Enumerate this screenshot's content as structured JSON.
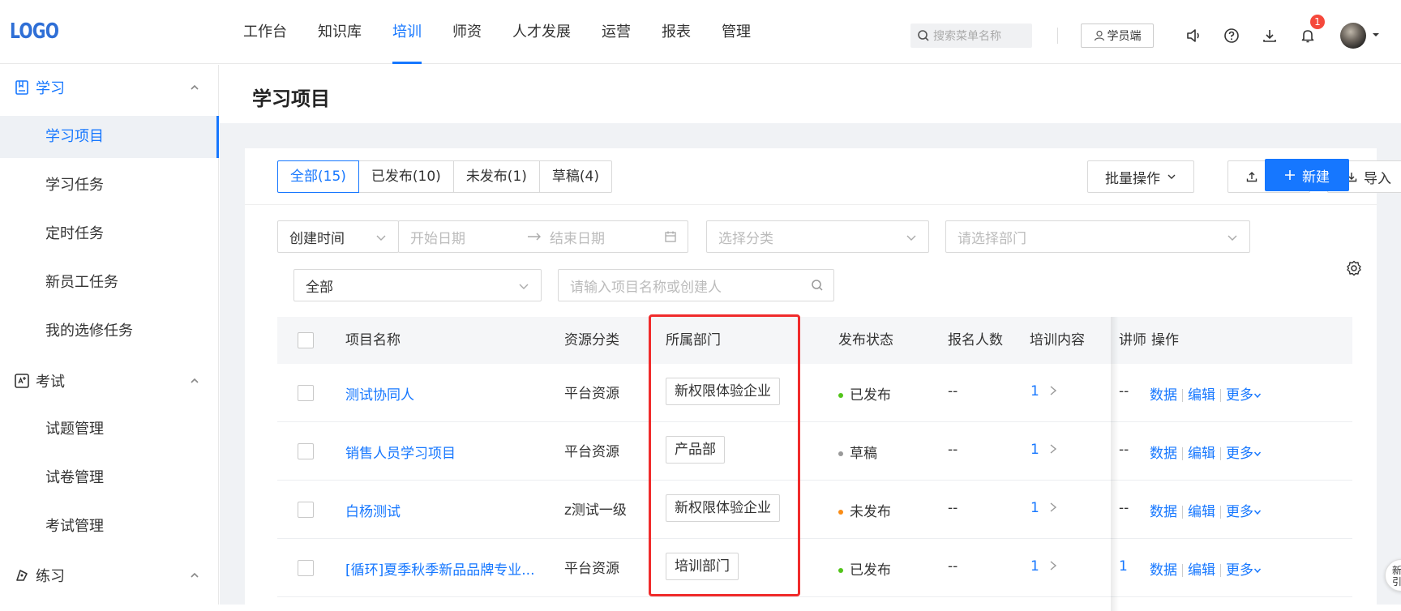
{
  "header": {
    "logo": "LOGO",
    "nav": [
      "工作台",
      "知识库",
      "培训",
      "师资",
      "人才发展",
      "运营",
      "报表",
      "管理"
    ],
    "nav_active": "培训",
    "search_placeholder": "搜索菜单名称",
    "student_btn": "学员端",
    "notify_count": "1",
    "icons": [
      "speaker-icon",
      "help-icon",
      "download-icon",
      "bell-icon"
    ]
  },
  "sidebar": {
    "groups": [
      {
        "label": "学习",
        "icon": "book-icon",
        "items": [
          "学习项目",
          "学习任务",
          "定时任务",
          "新员工任务",
          "我的选修任务"
        ]
      },
      {
        "label": "考试",
        "icon": "exam-icon",
        "items": [
          "试题管理",
          "试卷管理",
          "考试管理"
        ]
      },
      {
        "label": "练习",
        "icon": "practice-icon",
        "items": []
      }
    ],
    "active_item": "学习项目"
  },
  "page": {
    "title": "学习项目",
    "tabs": [
      "全部(15)",
      "已发布(10)",
      "未发布(1)",
      "草稿(4)"
    ],
    "actions": {
      "batch": "批量操作",
      "export": "导出",
      "import": "导入",
      "create": "新建"
    },
    "filters": {
      "time_type": "创建时间",
      "start_placeholder": "开始日期",
      "end_placeholder": "结束日期",
      "category_placeholder": "选择分类",
      "dept_placeholder": "请选择部门",
      "scope": "全部",
      "keyword_placeholder": "请输入项目名称或创建人"
    },
    "table": {
      "headers": [
        "项目名称",
        "资源分类",
        "所属部门",
        "发布状态",
        "报名人数",
        "培训内容",
        "讲师",
        "操作"
      ],
      "rows": [
        {
          "name": "测试协同人",
          "category": "平台资源",
          "dept": "新权限体验企业",
          "status": "已发布",
          "status_color": "#52c41a",
          "enroll": "--",
          "content": "1",
          "lecturer": "--",
          "ops": [
            "数据",
            "编辑",
            "更多"
          ]
        },
        {
          "name": "销售人员学习项目",
          "category": "平台资源",
          "dept": "产品部",
          "status": "草稿",
          "status_color": "#999999",
          "enroll": "--",
          "content": "1",
          "lecturer": "--",
          "ops": [
            "数据",
            "编辑",
            "更多"
          ]
        },
        {
          "name": "白杨测试",
          "category": "z测试一级",
          "dept": "新权限体验企业",
          "status": "未发布",
          "status_color": "#fa8c16",
          "enroll": "--",
          "content": "1",
          "lecturer": "--",
          "ops": [
            "数据",
            "编辑",
            "更多"
          ]
        },
        {
          "name": "[循环]夏季秋季新品品牌专业...",
          "category": "平台资源",
          "dept": "培训部门",
          "status": "已发布",
          "status_color": "#52c41a",
          "enroll": "--",
          "content": "1",
          "lecturer": "1",
          "ops": [
            "数据",
            "编辑",
            "更多"
          ]
        }
      ]
    },
    "float_text": "新手引导"
  }
}
